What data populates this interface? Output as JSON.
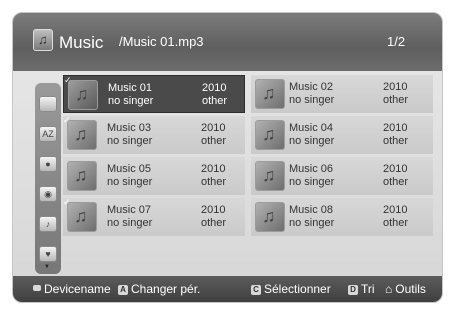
{
  "header": {
    "title": "Music",
    "path": "/Music 01.mp3",
    "page": "1/2",
    "icon": "music-folder-icon"
  },
  "sidebar": {
    "items": [
      {
        "icon": "folder-icon",
        "label": ""
      },
      {
        "icon": "sort-az-icon",
        "label": "AZ"
      },
      {
        "icon": "person-icon",
        "label": ""
      },
      {
        "icon": "disc-icon",
        "label": ""
      },
      {
        "icon": "guitar-icon",
        "label": ""
      },
      {
        "icon": "heart-icon",
        "label": ""
      }
    ]
  },
  "tracks": [
    {
      "title": "Music 01",
      "year": "2010",
      "artist": "no singer",
      "genre": "other",
      "checked": true
    },
    {
      "title": "Music 02",
      "year": "2010",
      "artist": "no singer",
      "genre": "other",
      "checked": false
    },
    {
      "title": "Music 03",
      "year": "2010",
      "artist": "no singer",
      "genre": "other",
      "checked": true
    },
    {
      "title": "Music 04",
      "year": "2010",
      "artist": "no singer",
      "genre": "other",
      "checked": false
    },
    {
      "title": "Music 05",
      "year": "2010",
      "artist": "no singer",
      "genre": "other",
      "checked": false
    },
    {
      "title": "Music 06",
      "year": "2010",
      "artist": "no singer",
      "genre": "other",
      "checked": false
    },
    {
      "title": "Music 07",
      "year": "2010",
      "artist": "no singer",
      "genre": "other",
      "checked": true
    },
    {
      "title": "Music 08",
      "year": "2010",
      "artist": "no singer",
      "genre": "other",
      "checked": false
    }
  ],
  "bottom": {
    "device": "Devicename",
    "change_key": "A",
    "change": "Changer pér.",
    "select_key": "C",
    "select": "Sélectionner",
    "sort_key": "D",
    "sort": "Tri",
    "tools": "Outils"
  }
}
